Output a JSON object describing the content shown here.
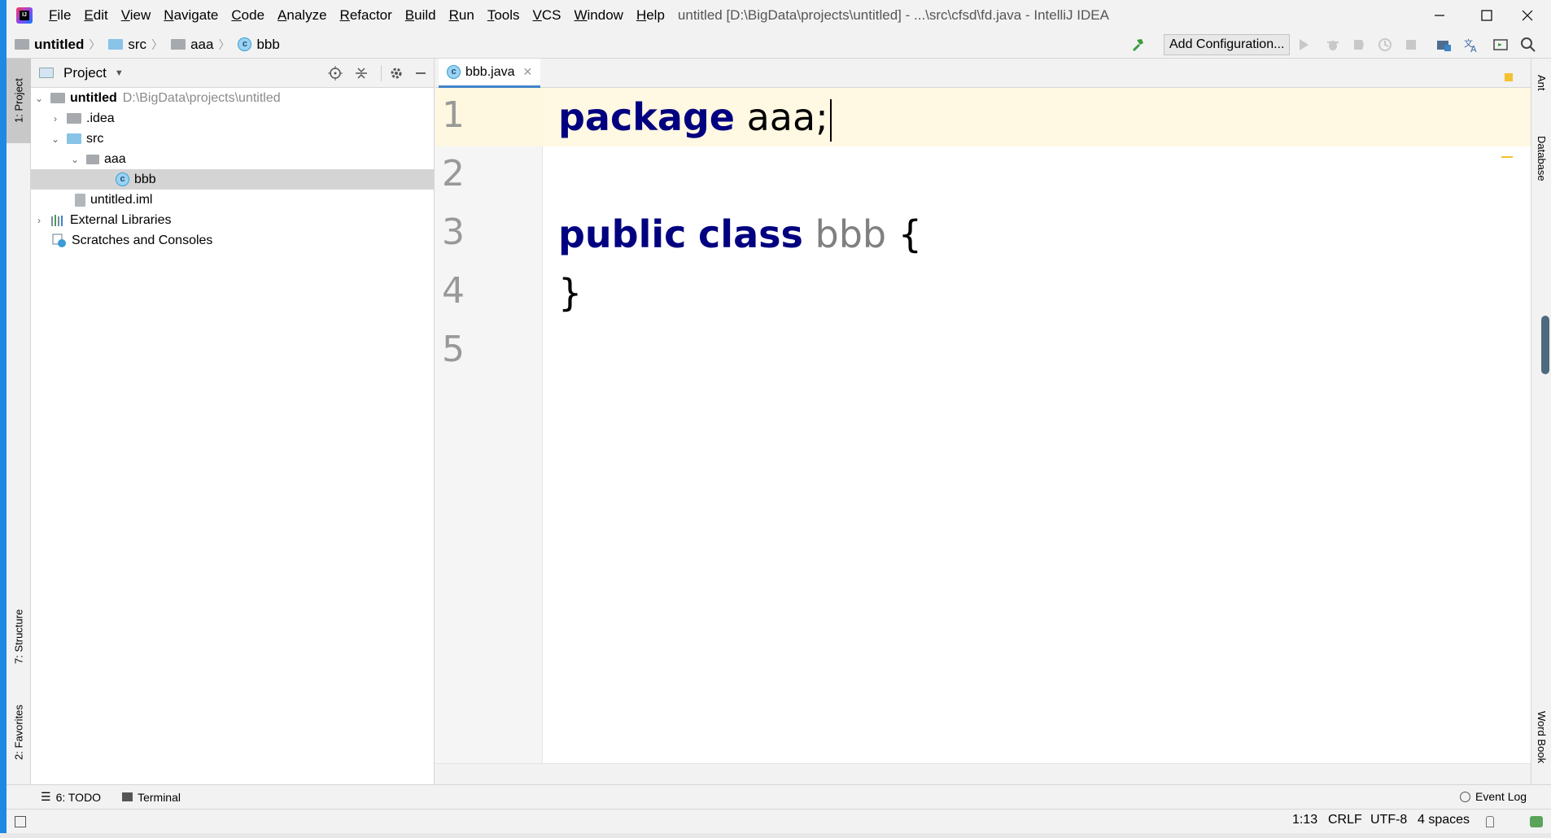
{
  "window": {
    "title": "untitled [D:\\BigData\\projects\\untitled] - ...\\src\\cfsd\\fd.java - IntelliJ IDEA",
    "logo_text": "IJ"
  },
  "menu": [
    "File",
    "Edit",
    "View",
    "Navigate",
    "Code",
    "Analyze",
    "Refactor",
    "Build",
    "Run",
    "Tools",
    "VCS",
    "Window",
    "Help"
  ],
  "breadcrumb": {
    "project": "untitled",
    "folder1": "src",
    "folder2": "aaa",
    "file": "bbb"
  },
  "toolbar": {
    "add_configuration": "Add Configuration..."
  },
  "left_tools": {
    "project_tab": "1: Project",
    "structure_tab": "7: Structure",
    "favorites_tab": "2: Favorites"
  },
  "project_panel": {
    "title": "Project",
    "tree": [
      {
        "label": "untitled",
        "path": "D:\\BigData\\projects\\untitled"
      },
      {
        "label": ".idea"
      },
      {
        "label": "src"
      },
      {
        "label": "aaa"
      },
      {
        "label": "bbb"
      },
      {
        "label": "untitled.iml"
      },
      {
        "label": "External Libraries"
      },
      {
        "label": "Scratches and Consoles"
      }
    ]
  },
  "editor": {
    "tab_label": "bbb.java",
    "line_numbers": [
      "1",
      "2",
      "3",
      "4",
      "5"
    ],
    "code": {
      "l1_kw": "package",
      "l1_rest": " aaa;",
      "l3_kw1": "public",
      "l3_kw2": "class",
      "l3_name": "bbb",
      "l3_brace": "{",
      "l4": "}"
    }
  },
  "right_tools": {
    "ant": "Ant",
    "database": "Database",
    "word_book": "Word Book"
  },
  "bottom_tools": {
    "todo": "6: TODO",
    "terminal": "Terminal",
    "event_log": "Event Log"
  },
  "status": {
    "position": "1:13",
    "line_sep": "CRLF",
    "encoding": "UTF-8",
    "indent": "4 spaces"
  },
  "colors": {
    "keyword": "#000080",
    "class_name": "#808080",
    "current_line": "#fff8e2",
    "selection": "#d4d4d4"
  }
}
